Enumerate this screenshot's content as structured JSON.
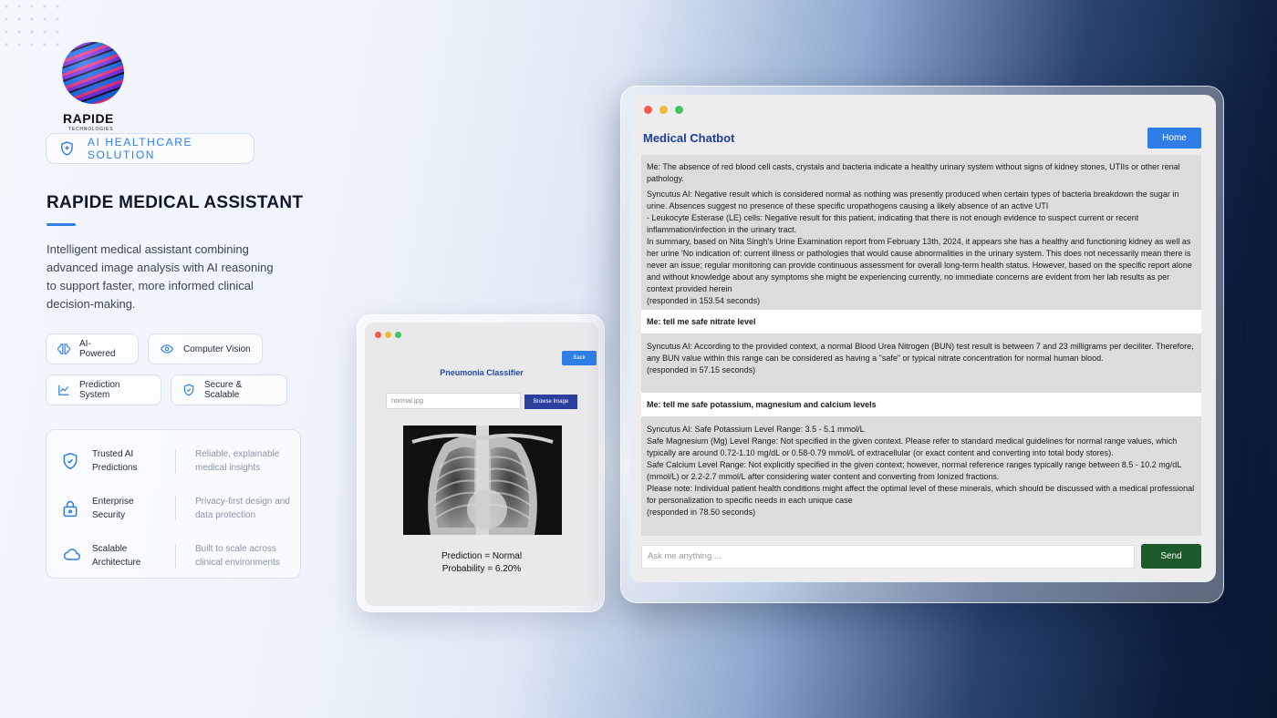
{
  "brand": {
    "name": "RAPIDE",
    "subname": "TECHNOLOGIES",
    "pill": "AI HEALTHCARE SOLUTION",
    "title": "RAPIDE MEDICAL ASSISTANT",
    "description": "Intelligent medical assistant combining advanced image analysis with AI reasoning to support faster, more informed clinical decision-making."
  },
  "tags": [
    "AI-Powered",
    "Computer Vision",
    "Prediction System",
    "Secure & Scalable"
  ],
  "features": [
    {
      "title": "Trusted AI Predictions",
      "desc": "Reliable, explainable medical insights",
      "icon": "shield-check-icon"
    },
    {
      "title": "Enterprise Security",
      "desc": "Privacy-first design and data protection",
      "icon": "lock-icon"
    },
    {
      "title": "Scalable Architecture",
      "desc": "Built to scale across clinical environments",
      "icon": "cloud-icon"
    }
  ],
  "classifier": {
    "back": "Back",
    "title": "Pneumonia Classifier",
    "file_value": "normal.jpg",
    "browse": "Browse Image",
    "prediction": "Prediction = Normal",
    "probability": "Probability = 6.20%"
  },
  "chatbot": {
    "title": "Medical Chatbot",
    "home": "Home",
    "ask_placeholder": "Ask me anything ...",
    "send": "Send",
    "messages": [
      {
        "role": "ai",
        "lines": [
          "Me: The absence of red blood cell casts, crystals and bacteria indicate a healthy urinary system without signs of kidney stones, UTIIs or other renal pathology.",
          "Syncutus AI:  Negative result which is considered normal as nothing was presently produced when certain types of bacteria breakdown the sugar in urine. Absences suggest no presence of these specific uropathogens causing a likely absence of an active UTI",
          "- Leukocyte Esterase (LE) cells: Negative result for this patient, indicating that there is not enough evidence to suspect current or recent inflammation/infection in the urinary tract.",
          "In summary, based on Nita Singh's Urine Examination report from February 13th, 2024, it appears she has a healthy and functioning kidney as well as her urine 'No indication of: current illness or pathologies that would cause abnormalities in the urinary system. This does not necessarily mean there is never an issue; regular monitoring can provide continuous assessment for overall long-term health status. However, based on the specific report alone and without knowledge about any symptoms she might be experiencing currently, no immediate concerns are evident from her lab results as per context provided herein",
          "(responded in 153.54 seconds)"
        ]
      },
      {
        "role": "me",
        "lines": [
          "Me: tell me safe nitrate level"
        ]
      },
      {
        "role": "ai",
        "lines": [
          "Syncutus AI:  According to the provided context, a normal Blood Urea Nitrogen (BUN) test result is between 7 and 23 milligrams per deciliter. Therefore, any BUN value within this range can be considered as having a \"safe\" or typical nitrate concentration for normal human blood.",
          "(responded in 57.15 seconds)"
        ]
      },
      {
        "role": "me",
        "lines": [
          "Me: tell me safe potassium, magnesium and calcium levels"
        ]
      },
      {
        "role": "ai",
        "lines": [
          "Syncutus AI:  Safe Potassium Level Range: 3.5 - 5.1 mmol/L",
          "Safe Magnesium (Mg) Level Range: Not specified in the given context. Please refer to standard medical guidelines for normal range values, which typically are around 0.72-1.10 mg/dL or 0.58-0.79 mmol/L of extracellular (or exact content and converting into total body stores).",
          "Safe Calcium Level Range: Not explicitly specified in the given context; however, normal reference ranges typically range between 8.5 - 10.2 mg/dL (mmol/L) or 2.2-2.7 mmol/L after considering water content and converting from Ionized fractions.",
          "Please note: Individual patient health conditions might affect the optimal level of these minerals, which should be discussed with a medical professional for personalization to specific needs in each unique case",
          "(responded in 78.50 seconds)"
        ]
      }
    ]
  }
}
